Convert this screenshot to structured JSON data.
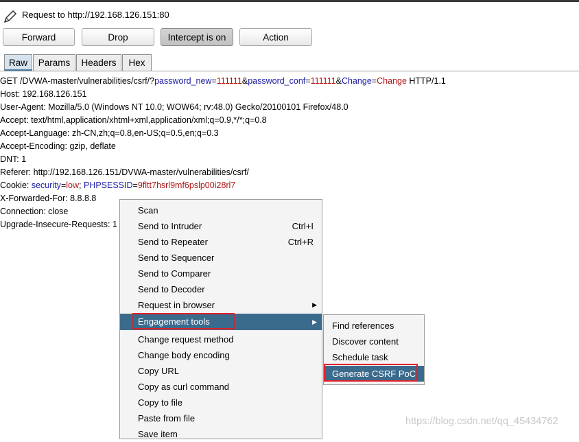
{
  "header": {
    "title": "Request to http://192.168.126.151:80"
  },
  "toolbar": {
    "forward": "Forward",
    "drop": "Drop",
    "intercept": "Intercept is on",
    "action": "Action"
  },
  "tabs": [
    "Raw",
    "Params",
    "Headers",
    "Hex"
  ],
  "request": {
    "get_prefix": "GET /DVWA-master/vulnerabilities/csrf/?",
    "param1_name": "password_new",
    "param1_value": "111111",
    "param2_name": "password_conf",
    "param2_value": "111111",
    "param3_name": "Change",
    "param3_value": "Change",
    "get_suffix": " HTTP/1.1",
    "host": "Host: 192.168.126.151",
    "user_agent": "User-Agent: Mozilla/5.0 (Windows NT 10.0; WOW64; rv:48.0) Gecko/20100101 Firefox/48.0",
    "accept": "Accept: text/html,application/xhtml+xml,application/xml;q=0.9,*/*;q=0.8",
    "accept_language": "Accept-Language: zh-CN,zh;q=0.8,en-US;q=0.5,en;q=0.3",
    "accept_encoding": "Accept-Encoding: gzip, deflate",
    "dnt": "DNT: 1",
    "referer": "Referer: http://192.168.126.151/DVWA-master/vulnerabilities/csrf/",
    "cookie_prefix": "Cookie: ",
    "cookie1_name": "security",
    "cookie1_value": "low",
    "cookie2_name": "PHPSESSID",
    "cookie2_value": "9fltt7hsrl9mf6pslp00i28rl7",
    "x_forwarded": "X-Forwarded-For: 8.8.8.8",
    "connection": "Connection: close",
    "upgrade": "Upgrade-Insecure-Requests: 1"
  },
  "context_menu": {
    "items": [
      {
        "label": "Scan",
        "shortcut": ""
      },
      {
        "label": "Send to Intruder",
        "shortcut": "Ctrl+I"
      },
      {
        "label": "Send to Repeater",
        "shortcut": "Ctrl+R"
      },
      {
        "label": "Send to Sequencer",
        "shortcut": ""
      },
      {
        "label": "Send to Comparer",
        "shortcut": ""
      },
      {
        "label": "Send to Decoder",
        "shortcut": ""
      },
      {
        "label": "Request in browser",
        "shortcut": ""
      },
      {
        "label": "Engagement tools",
        "shortcut": ""
      },
      {
        "label": "Change request method",
        "shortcut": ""
      },
      {
        "label": "Change body encoding",
        "shortcut": ""
      },
      {
        "label": "Copy URL",
        "shortcut": ""
      },
      {
        "label": "Copy as curl command",
        "shortcut": ""
      },
      {
        "label": "Copy to file",
        "shortcut": ""
      },
      {
        "label": "Paste from file",
        "shortcut": ""
      },
      {
        "label": "Save item",
        "shortcut": ""
      }
    ]
  },
  "submenu": {
    "items": [
      "Find references",
      "Discover content",
      "Schedule task",
      "Generate CSRF PoC"
    ]
  },
  "watermark": "https://blog.csdn.net/qq_45434762",
  "colors": {
    "highlight": "#3b6b8c",
    "param_name": "#1a1aa6",
    "param_value": "#b01515",
    "annotation": "#e0202a"
  }
}
